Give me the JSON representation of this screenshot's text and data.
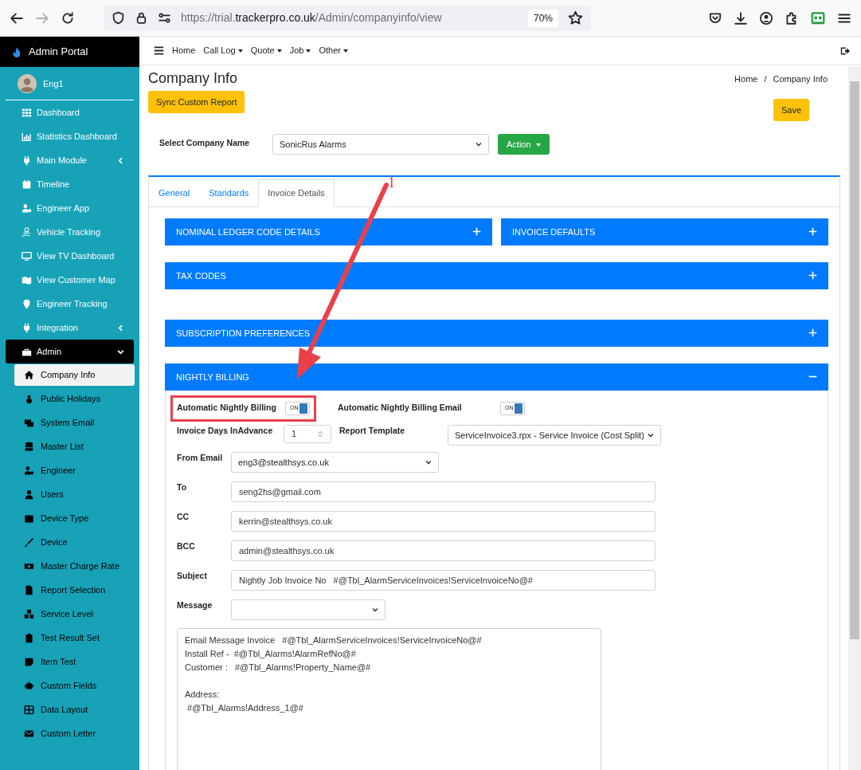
{
  "browser": {
    "url_parts": [
      "https://trial.",
      "trackerpro.co.uk",
      "/Admin/companyinfo/view"
    ],
    "zoom": "70%",
    "forward_disabled": true
  },
  "sidebar": {
    "brand": "Admin Portal",
    "user": "Eng1",
    "items": [
      {
        "label": "Dashboard",
        "selected": false
      },
      {
        "label": "Statistics Dashboard",
        "selected": false
      },
      {
        "label": "Main Module",
        "selected": false,
        "expanded": false
      },
      {
        "label": "Timeline",
        "selected": false
      },
      {
        "label": "Engineer App",
        "selected": false
      },
      {
        "label": "Vehicle Tracking",
        "selected": false
      },
      {
        "label": "View TV Dashboard",
        "selected": false
      },
      {
        "label": "View Customer Map",
        "selected": false
      },
      {
        "label": "Engineer Tracking",
        "selected": false
      },
      {
        "label": "Integration",
        "selected": false,
        "expanded": false
      },
      {
        "label": "Admin",
        "selected": true,
        "expanded": true,
        "children": [
          {
            "label": "Company Info",
            "selected": true
          },
          {
            "label": "Public Holidays",
            "selected": false
          },
          {
            "label": "System Email",
            "selected": false
          },
          {
            "label": "Master List",
            "selected": false
          },
          {
            "label": "Engineer",
            "selected": false
          },
          {
            "label": "Users",
            "selected": false
          },
          {
            "label": "Device Type",
            "selected": false
          },
          {
            "label": "Device",
            "selected": false
          },
          {
            "label": "Master Charge Rate",
            "selected": false
          },
          {
            "label": "Report Selection",
            "selected": false
          },
          {
            "label": "Service Level",
            "selected": false
          },
          {
            "label": "Test Result Set",
            "selected": false
          },
          {
            "label": "Item Test",
            "selected": false
          },
          {
            "label": "Custom Fields",
            "selected": false
          },
          {
            "label": "Data Layout",
            "selected": false
          },
          {
            "label": "Custom Letter",
            "selected": false
          }
        ]
      }
    ]
  },
  "topnav": [
    {
      "label": "Home",
      "dropdown": false
    },
    {
      "label": "Call Log",
      "dropdown": true
    },
    {
      "label": "Quote",
      "dropdown": true
    },
    {
      "label": "Job",
      "dropdown": true
    },
    {
      "label": "Other",
      "dropdown": true
    }
  ],
  "page": {
    "title": "Company Info",
    "sync_button": "Sync Custom Report",
    "breadcrumb": [
      "Home",
      "Company Info"
    ],
    "breadcrumb_separator": "/",
    "save_button": "Save",
    "company_label": "Select Company Name",
    "company_value": "SonicRus Alarms",
    "action_button": "Action"
  },
  "tabs": [
    {
      "label": "General",
      "selected": false
    },
    {
      "label": "Standards",
      "selected": false
    },
    {
      "label": "Invoice Details",
      "selected": true
    }
  ],
  "panel_rows": [
    [
      {
        "title": "NOMINAL LEDGER CODE DETAILS",
        "expanded": false
      },
      {
        "title": "INVOICE DEFAULTS",
        "expanded": false
      }
    ],
    [
      {
        "title": "TAX CODES",
        "expanded": false
      }
    ],
    [
      {
        "title": "SUBSCRIPTION PREFERENCES",
        "expanded": false
      }
    ],
    [
      {
        "title": "NIGHTLY BILLING",
        "expanded": true
      }
    ]
  ],
  "nightly_billing": {
    "toggles": [
      {
        "label": "Automatic Nightly Billing",
        "text": "ON",
        "on": true,
        "highlighted": true
      },
      {
        "label": "Automatic Nightly Billing Email",
        "text": "ON",
        "on": true,
        "highlighted": false
      }
    ],
    "invoice_days": {
      "label": "Invoice Days InAdvance",
      "value": "1"
    },
    "report_template": {
      "label": "Report Template",
      "value": "ServiceInvoice3.rpx - Service Invoice (Cost Split)"
    },
    "fields": [
      {
        "label": "From Email",
        "kind": "select",
        "value": "eng3@stealthsys.co.uk"
      },
      {
        "label": "To",
        "kind": "text",
        "value": "seng2hs@gmail.com"
      },
      {
        "label": "CC",
        "kind": "text",
        "value": "kerrin@stealthsys.co.uk"
      },
      {
        "label": "BCC",
        "kind": "text",
        "value": "admin@stealthsys.co.uk"
      },
      {
        "label": "Subject",
        "kind": "text",
        "value": "Nightly Job Invoice No   #@Tbl_AlarmServiceInvoices!ServiceInvoiceNo@#"
      },
      {
        "label": "Message",
        "kind": "select-small"
      }
    ],
    "message_body": "Email Message Invoice   #@Tbl_AlarmServiceInvoices!ServiceInvoiceNo@#\nInstall Ref -  #@Tbl_Alarms!AlarmRefNo@#\nCustomer :   #@Tbl_Alarms!Property_Name@#\n\nAddress:\n #@Tbl_Alarms!Address_1@#"
  },
  "annotation": {
    "label": "1"
  }
}
